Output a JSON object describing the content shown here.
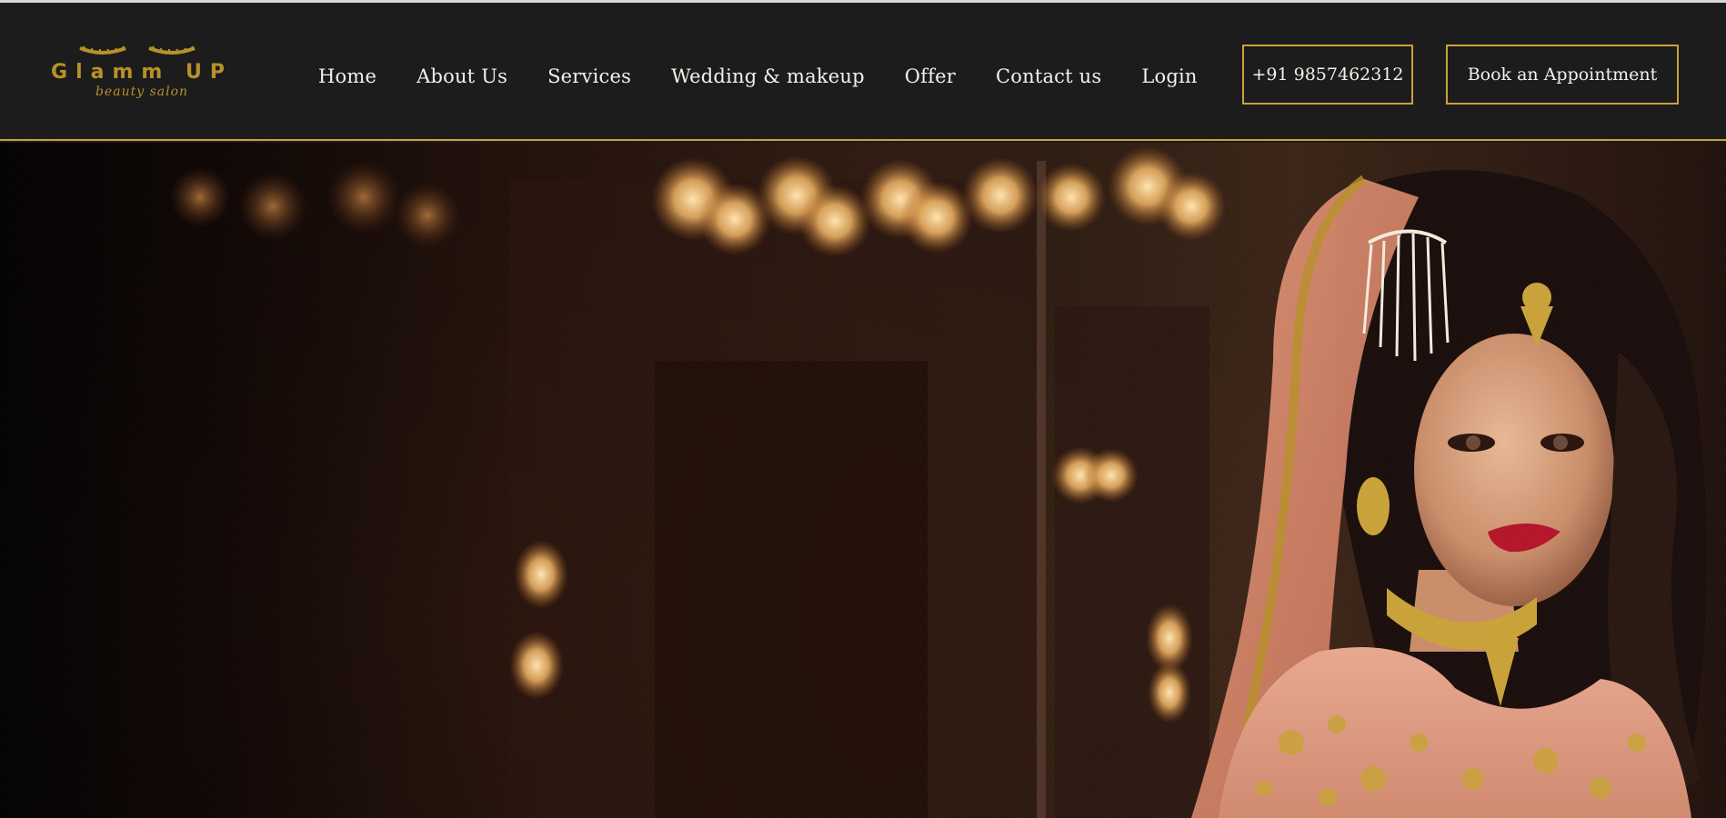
{
  "brand": {
    "name": "Glamm UP",
    "tagline": "beauty salon",
    "accent_color": "#c9a23a"
  },
  "nav": {
    "items": [
      {
        "label": "Home"
      },
      {
        "label": "About Us"
      },
      {
        "label": "Services"
      },
      {
        "label": "Wedding & makeup"
      },
      {
        "label": "Offer"
      },
      {
        "label": "Contact us"
      },
      {
        "label": "Login"
      }
    ],
    "phone": "+91 9857462312",
    "cta": "Book an Appointment"
  },
  "hero": {
    "image": "bridal-portrait-photo"
  }
}
